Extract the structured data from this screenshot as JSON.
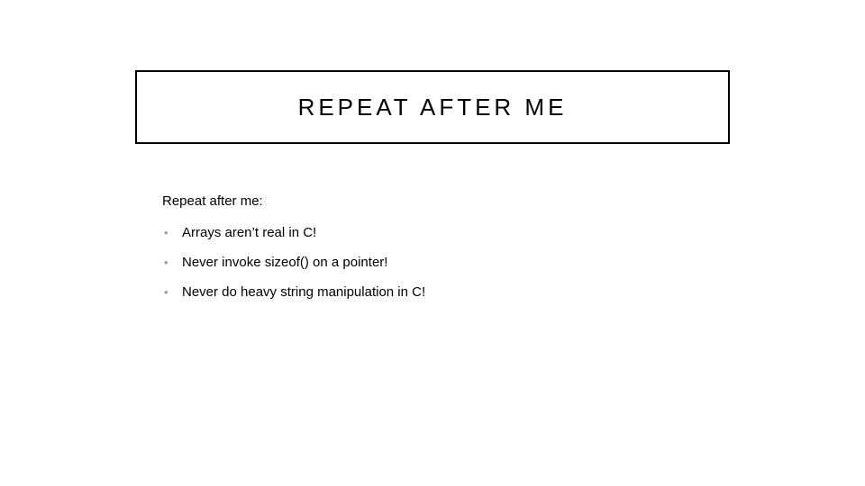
{
  "title": "REPEAT AFTER ME",
  "lead": "Repeat after me:",
  "bullets": [
    "Arrays aren’t real in C!",
    "Never invoke sizeof() on a pointer!",
    "Never do heavy string manipulation in C!"
  ]
}
